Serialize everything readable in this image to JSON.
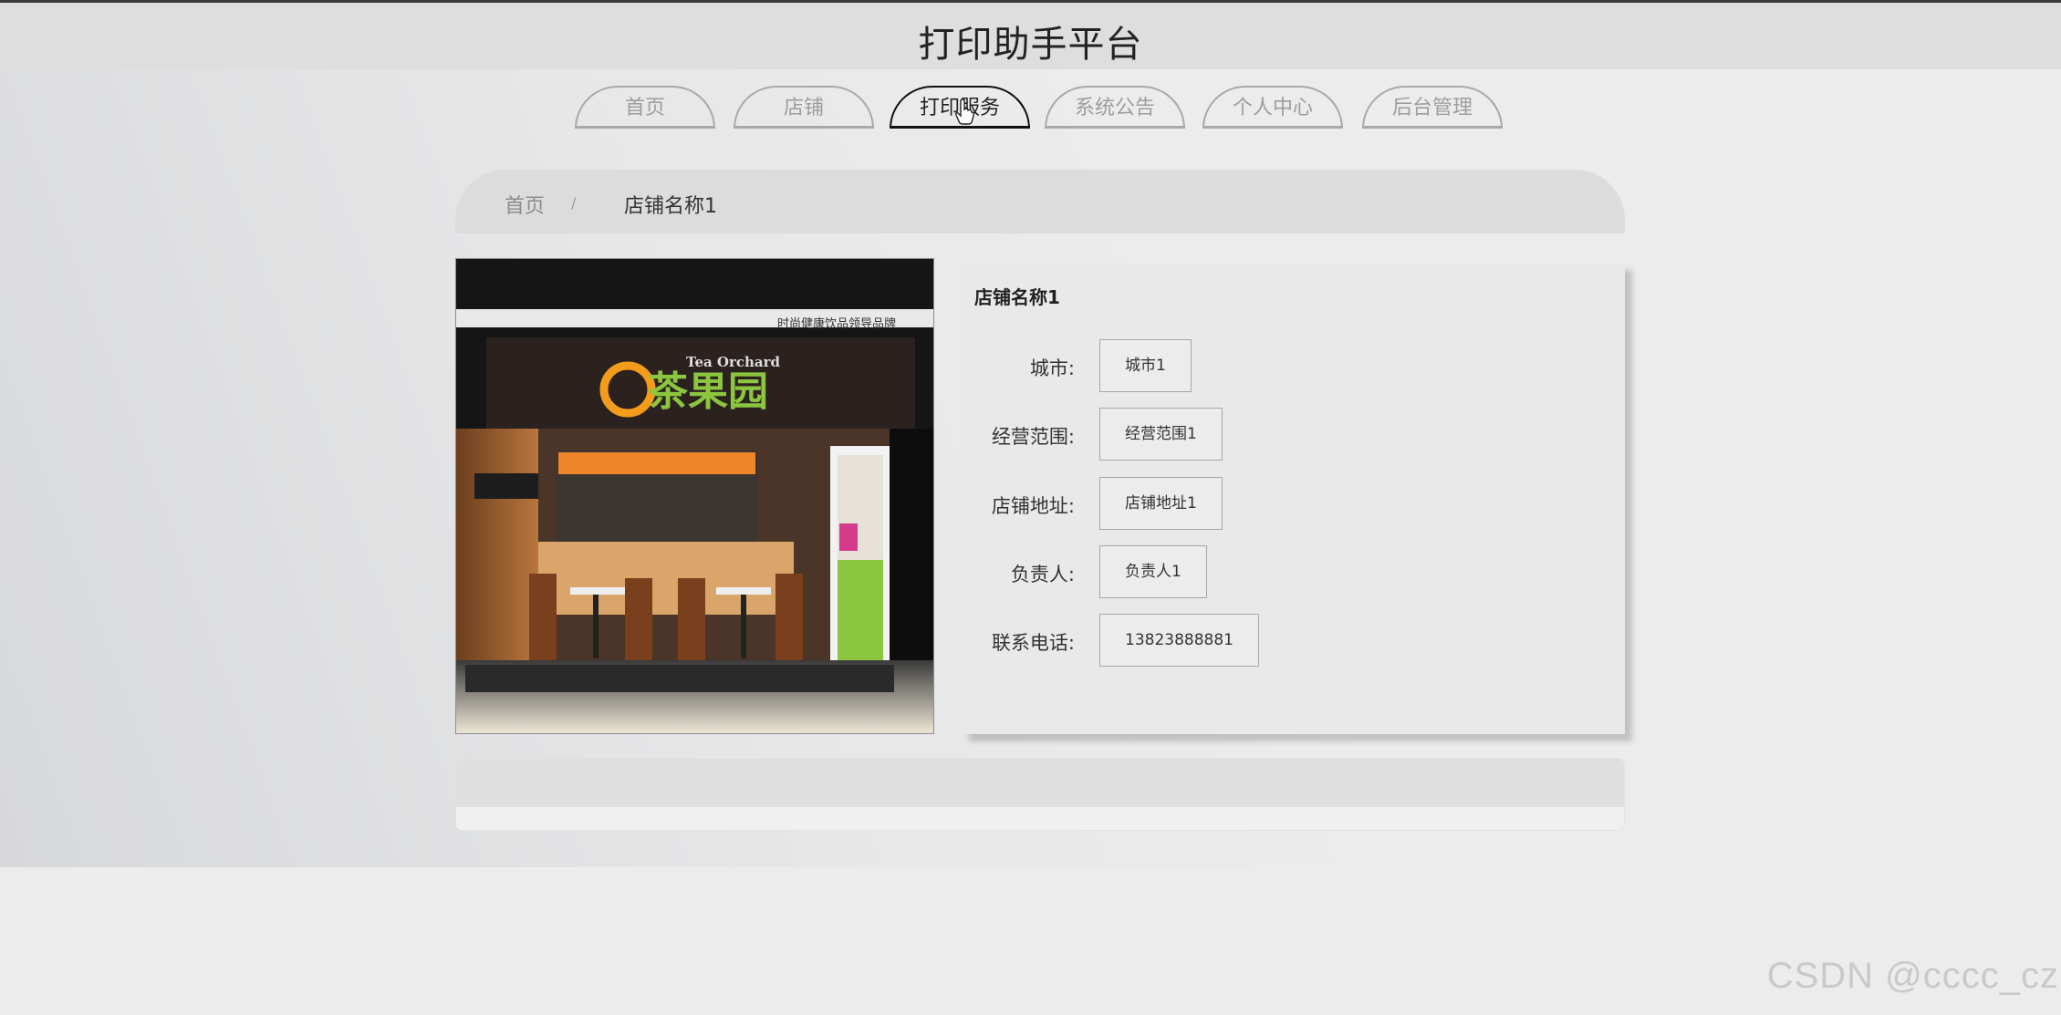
{
  "header": {
    "title": "打印助手平台"
  },
  "nav": {
    "items": [
      {
        "label": "首页",
        "active": false
      },
      {
        "label": "店铺",
        "active": false
      },
      {
        "label": "打印服务",
        "active": true
      },
      {
        "label": "系统公告",
        "active": false
      },
      {
        "label": "个人中心",
        "active": false
      },
      {
        "label": "后台管理",
        "active": false
      }
    ]
  },
  "breadcrumb": {
    "home": "首页",
    "separator": "/",
    "current": "店铺名称1"
  },
  "store": {
    "name": "店铺名称1",
    "photo_texts": {
      "logo_en": "Tea Orchard",
      "logo_cn": "茶果园",
      "banner": "时尚健康饮品领导品牌"
    },
    "fields": [
      {
        "label": "城市:",
        "value": "城市1"
      },
      {
        "label": "经营范围:",
        "value": "经营范围1"
      },
      {
        "label": "店铺地址:",
        "value": "店铺地址1"
      },
      {
        "label": "负责人:",
        "value": "负责人1"
      },
      {
        "label": "联系电话:",
        "value": "13823888881"
      }
    ]
  },
  "watermark": "CSDN @cccc_cz",
  "colors": {
    "accent_active": "#111111",
    "nav_border": "#a9a9a9",
    "header_bg": "#dedede"
  }
}
